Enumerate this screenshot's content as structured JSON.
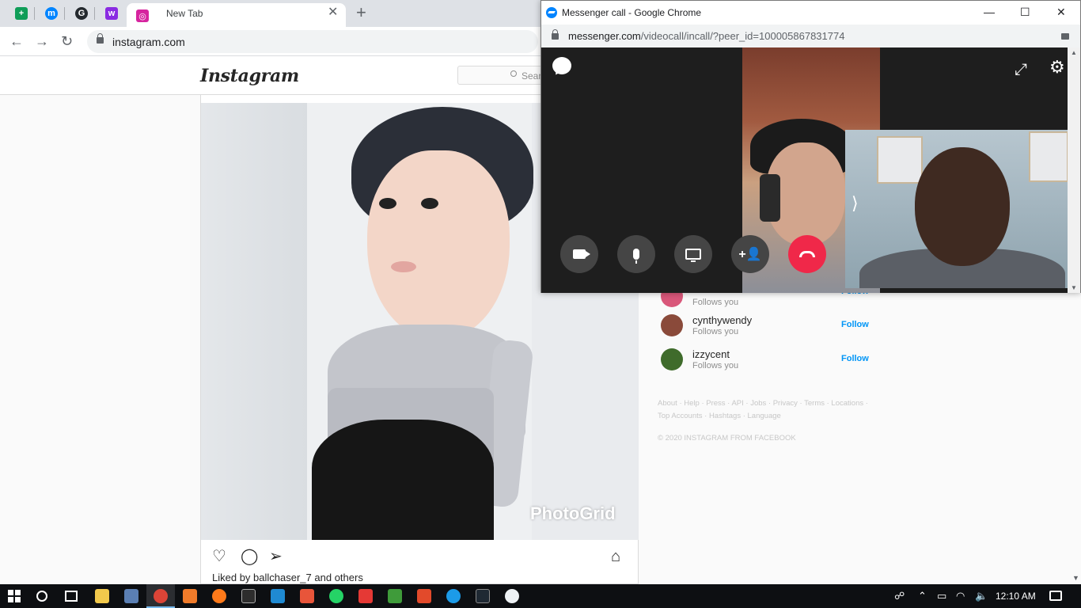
{
  "browser": {
    "pinned_tabs": [
      {
        "name": "google-sheets",
        "color": "#0f9d58",
        "glyph": "+"
      },
      {
        "name": "messenger",
        "color": "#0084ff",
        "glyph": "m"
      },
      {
        "name": "github",
        "color": "#24292e",
        "glyph": "G"
      },
      {
        "name": "wattpad",
        "color": "#8a2be2",
        "glyph": "w"
      },
      {
        "name": "instagram",
        "color": "#d6249f",
        "glyph": "◎"
      }
    ],
    "active_tab_title": "New Tab",
    "url": "instagram.com"
  },
  "instagram": {
    "logo": "Instagram",
    "search_placeholder": "Search",
    "post": {
      "watermark": "PhotoGrid",
      "liked_prefix": "Liked by",
      "liked_user": "ballchaser_7",
      "liked_suffix": "and others"
    },
    "suggestions": [
      {
        "username": "",
        "subtitle": "Follows you",
        "follow_label": "Follow",
        "avatar_color": "#d9577a"
      },
      {
        "username": "cynthywendy",
        "subtitle": "Follows you",
        "follow_label": "Follow",
        "avatar_color": "#8a4a3a"
      },
      {
        "username": "izzycent",
        "subtitle": "Follows you",
        "follow_label": "Follow",
        "avatar_color": "#3f6b2b"
      }
    ],
    "footer_links_line1": "About · Help · Press · API · Jobs · Privacy · Terms · Locations ·",
    "footer_links_line2": "Top Accounts · Hashtags · Language",
    "copyright": "© 2020 INSTAGRAM FROM FACEBOOK"
  },
  "messenger_window": {
    "title": "Messenger call - Google Chrome",
    "url_host": "messenger.com",
    "url_path": "/videocall/incall/?peer_id=100005867831774",
    "controls": [
      "camera",
      "microphone",
      "screen-share",
      "add-person",
      "end-call"
    ]
  },
  "taskbar": {
    "time": "12:10 AM"
  }
}
